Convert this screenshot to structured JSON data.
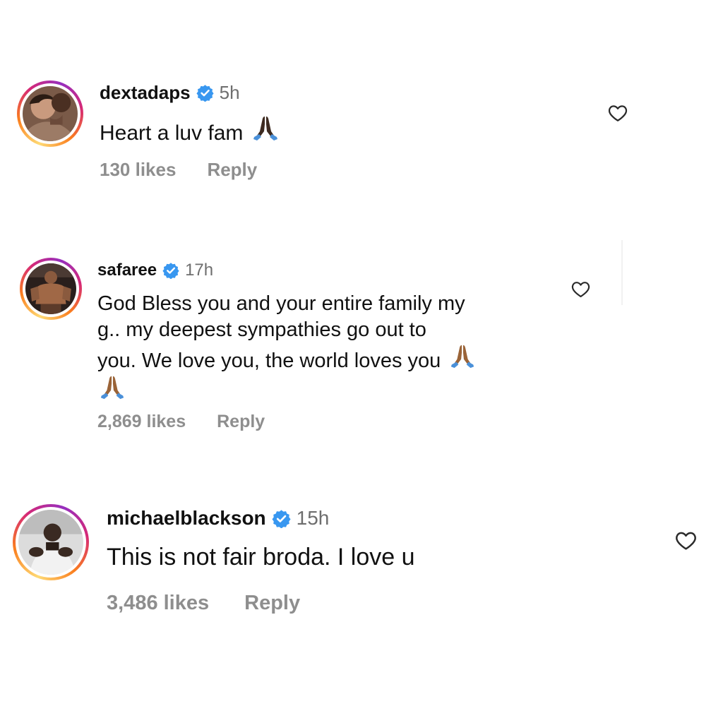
{
  "comments": [
    {
      "username": "dextadaps",
      "time": "5h",
      "text_lines": [
        "Heart a luv fam"
      ],
      "likes": "130 likes",
      "reply_label": "Reply",
      "verified": true,
      "emoji": "folded-hands",
      "like_icon": "heart-outline-icon"
    },
    {
      "username": "safaree",
      "time": "17h",
      "text_lines": [
        "God Bless you and your entire family my",
        "g.. my deepest sympathies go out to",
        "you. We love you, the world loves you"
      ],
      "likes": "2,869 likes",
      "reply_label": "Reply",
      "verified": true,
      "emoji": "folded-hands",
      "like_icon": "heart-outline-icon"
    },
    {
      "username": "michaelblackson",
      "time": "15h",
      "text_lines": [
        "This is not fair broda. I love u"
      ],
      "likes": "3,486 likes",
      "reply_label": "Reply",
      "verified": true,
      "like_icon": "heart-outline-icon"
    }
  ],
  "colors": {
    "verified_blue": "#3897f0",
    "meta_gray": "#8e8e8e",
    "time_gray": "#6e6e6e",
    "text": "#111111"
  }
}
